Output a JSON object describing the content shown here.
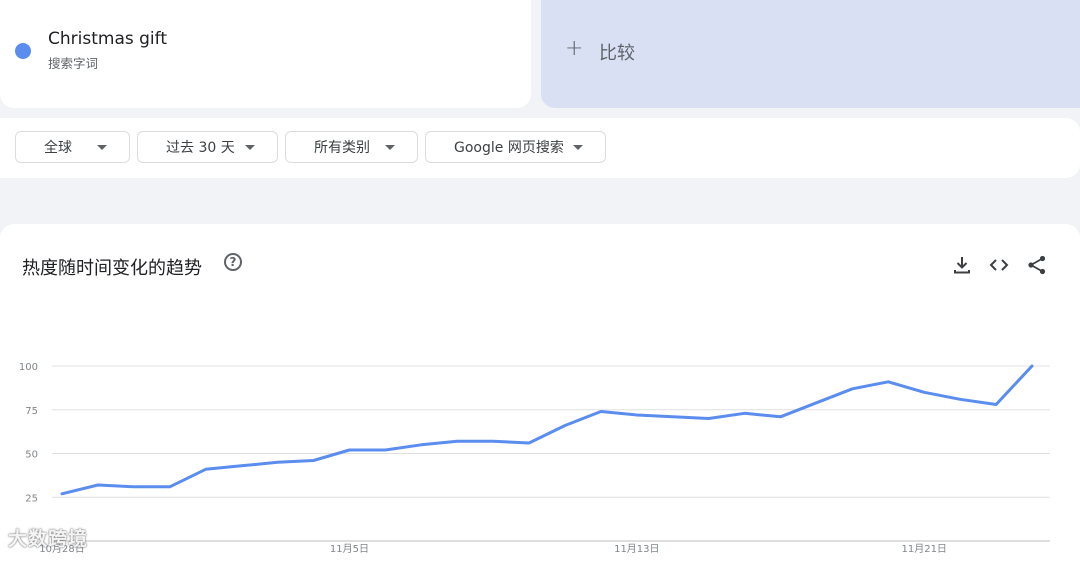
{
  "term": {
    "name": "Christmas gift",
    "subtitle": "搜索字词",
    "color": "#5b8def"
  },
  "compare": {
    "plus": "+",
    "label": "比较"
  },
  "filters": [
    {
      "label": "全球"
    },
    {
      "label": "过去 30 天"
    },
    {
      "label": "所有类别"
    },
    {
      "label": "Google 网页搜索"
    }
  ],
  "chart_section": {
    "title": "热度随时间变化的趋势",
    "help": "?",
    "actions": [
      "download-icon",
      "embed-icon",
      "share-icon"
    ]
  },
  "chart_data": {
    "type": "line",
    "x_labels": [
      "10月28日",
      "11月5日",
      "11月13日",
      "11月21日"
    ],
    "y_ticks": [
      25,
      50,
      75,
      100
    ],
    "ylim": [
      0,
      100
    ],
    "grid": true,
    "series": [
      {
        "color": "#5b8def",
        "values": [
          27,
          32,
          31,
          31,
          41,
          43,
          45,
          46,
          52,
          52,
          55,
          57,
          57,
          56,
          66,
          74,
          72,
          71,
          70,
          73,
          71,
          79,
          87,
          91,
          85,
          81,
          78,
          100
        ]
      }
    ]
  },
  "watermark": "大数跨境"
}
